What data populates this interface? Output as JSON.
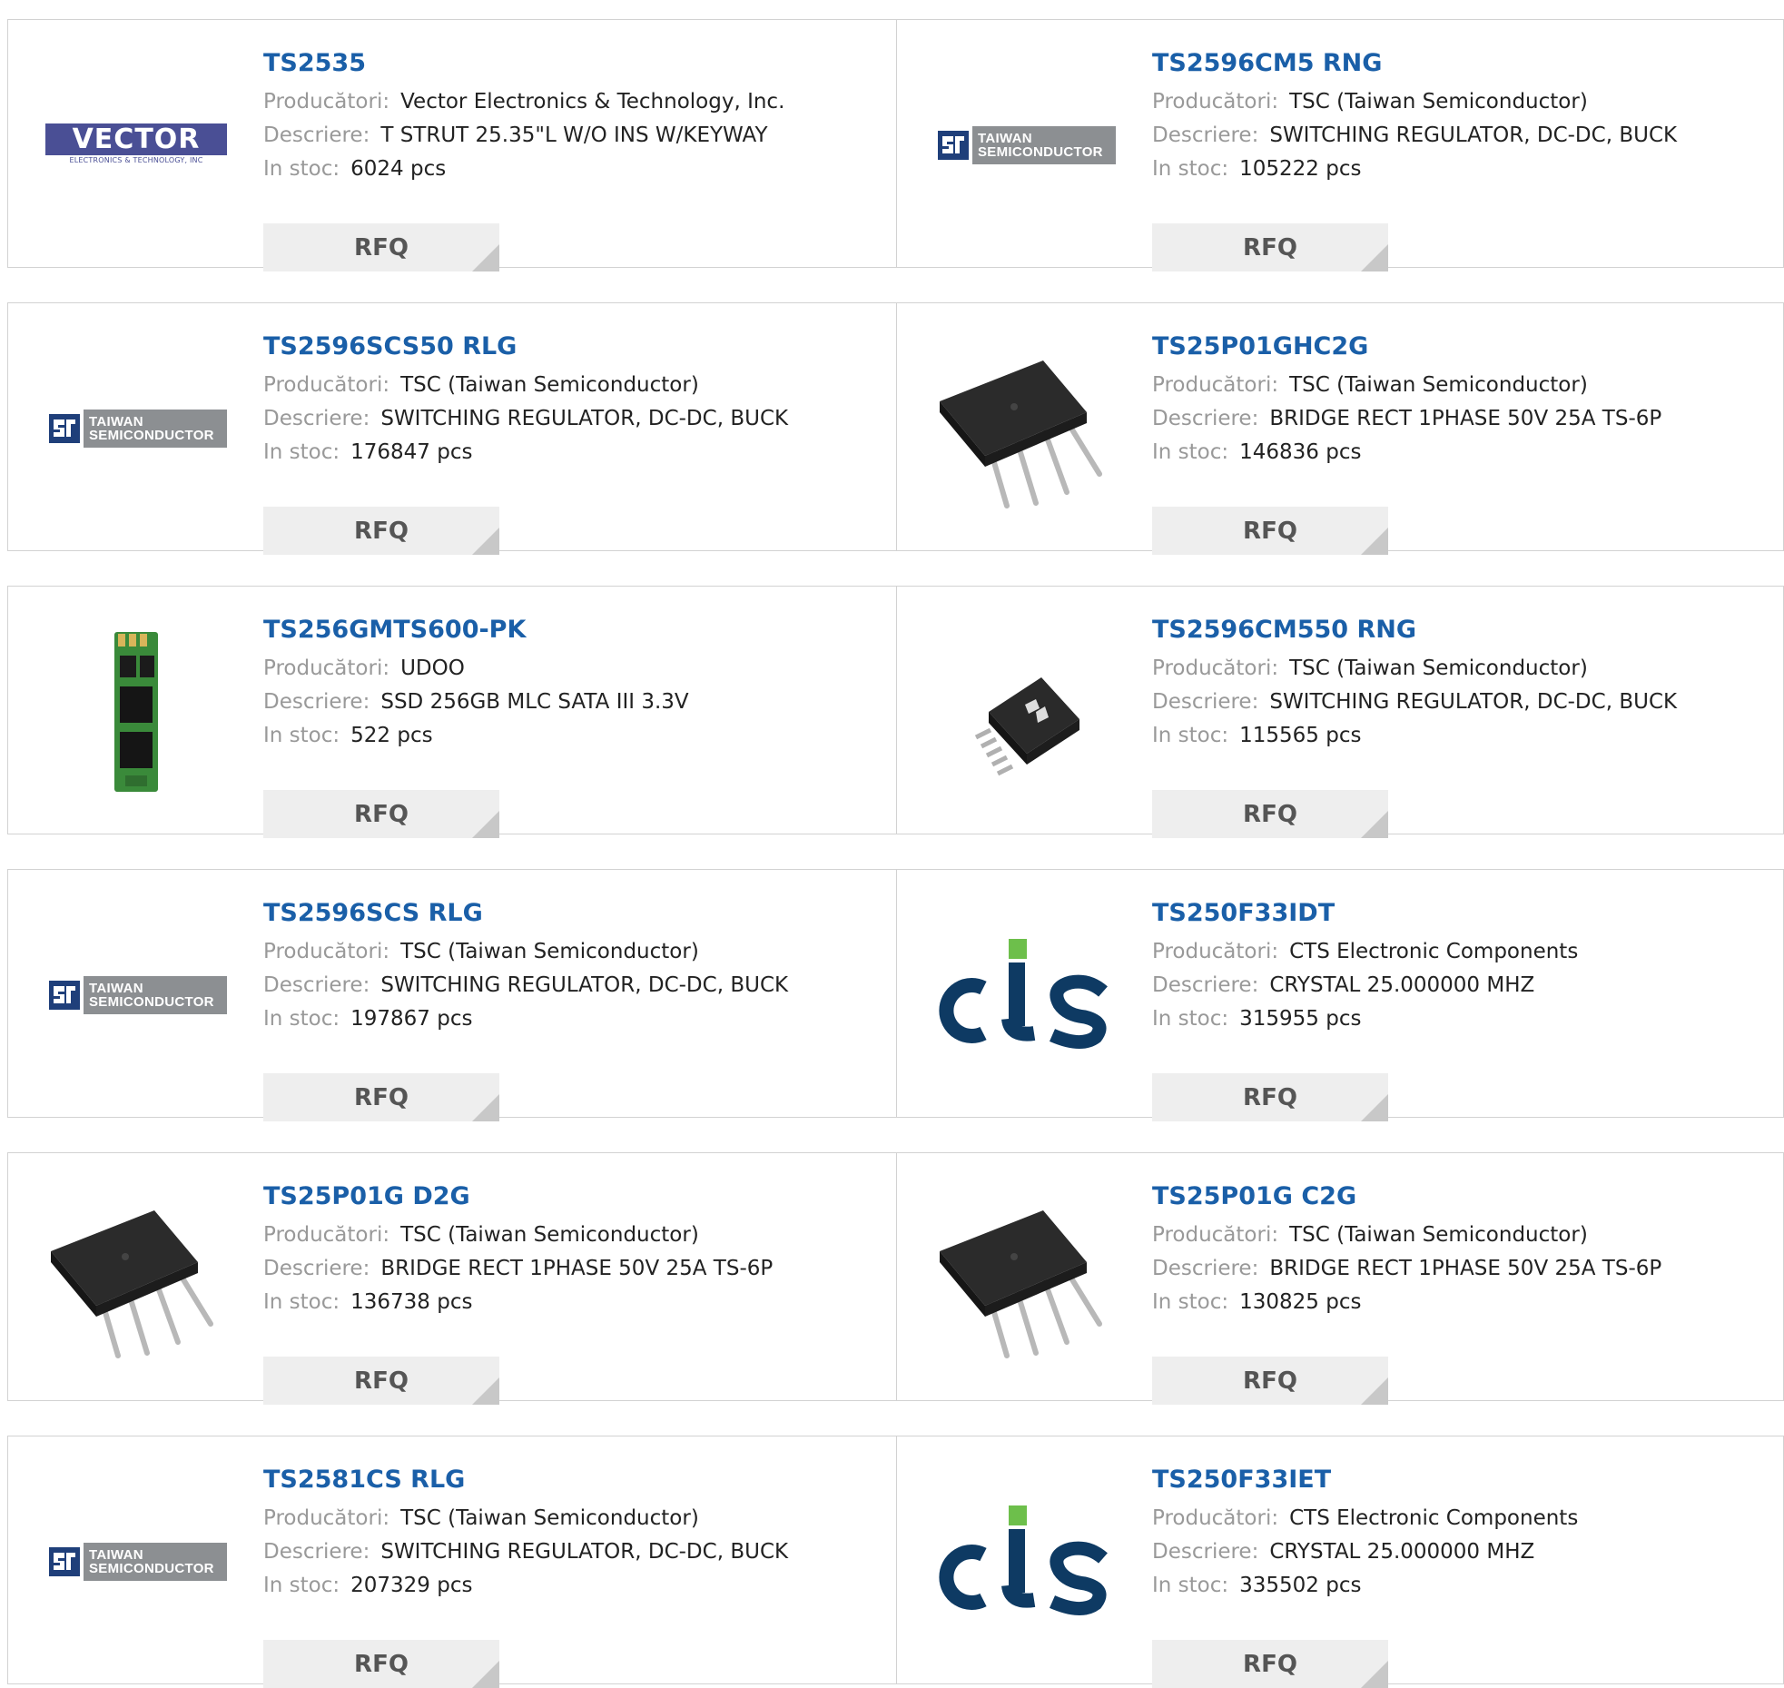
{
  "labels": {
    "manufacturer": "Producători:",
    "description": "Descriere:",
    "stock": "In stoc:",
    "rfq": "RFQ"
  },
  "logo_text": {
    "vector_title": "VECTOR",
    "vector_sub": "ELECTRONICS & TECHNOLOGY, INC",
    "tsc_line1": "TAIWAN",
    "tsc_line2": "SEMICONDUCTOR"
  },
  "colors": {
    "part_link": "#1a5fa8",
    "label_gray": "#999999",
    "rfq_bg": "#eeeeee",
    "cts_blue": "#0e3a63",
    "cts_green": "#6dbf4b",
    "tsc_gray": "#8c8f92",
    "vector_blue": "#4a4f95"
  },
  "products": [
    {
      "part": "TS2535",
      "manufacturer": "Vector Electronics & Technology, Inc.",
      "description": "T STRUT 25.35\"L W/O INS W/KEYWAY",
      "stock": "6024 pcs",
      "image": "vector-logo"
    },
    {
      "part": "TS2596CM5 RNG",
      "manufacturer": "TSC (Taiwan Semiconductor)",
      "description": "SWITCHING REGULATOR, DC-DC, BUCK",
      "stock": "105222 pcs",
      "image": "tsc-logo"
    },
    {
      "part": "TS2596SCS50 RLG",
      "manufacturer": "TSC (Taiwan Semiconductor)",
      "description": "SWITCHING REGULATOR, DC-DC, BUCK",
      "stock": "176847 pcs",
      "image": "tsc-logo"
    },
    {
      "part": "TS25P01GHC2G",
      "manufacturer": "TSC (Taiwan Semiconductor)",
      "description": "BRIDGE RECT 1PHASE 50V 25A TS-6P",
      "stock": "146836 pcs",
      "image": "bridge-rectifier-photo"
    },
    {
      "part": "TS256GMTS600-PK",
      "manufacturer": "UDOO",
      "description": "SSD 256GB MLC SATA III 3.3V",
      "stock": "522 pcs",
      "image": "m2-ssd-photo"
    },
    {
      "part": "TS2596CM550 RNG",
      "manufacturer": "TSC (Taiwan Semiconductor)",
      "description": "SWITCHING REGULATOR, DC-DC, BUCK",
      "stock": "115565 pcs",
      "image": "sop-chip-photo"
    },
    {
      "part": "TS2596SCS RLG",
      "manufacturer": "TSC (Taiwan Semiconductor)",
      "description": "SWITCHING REGULATOR, DC-DC, BUCK",
      "stock": "197867 pcs",
      "image": "tsc-logo"
    },
    {
      "part": "TS250F33IDT",
      "manufacturer": "CTS Electronic Components",
      "description": "CRYSTAL 25.000000 MHZ",
      "stock": "315955 pcs",
      "image": "cts-logo"
    },
    {
      "part": "TS25P01G D2G",
      "manufacturer": "TSC (Taiwan Semiconductor)",
      "description": "BRIDGE RECT 1PHASE 50V 25A TS-6P",
      "stock": "136738 pcs",
      "image": "bridge-rectifier-photo"
    },
    {
      "part": "TS25P01G C2G",
      "manufacturer": "TSC (Taiwan Semiconductor)",
      "description": "BRIDGE RECT 1PHASE 50V 25A TS-6P",
      "stock": "130825 pcs",
      "image": "bridge-rectifier-photo"
    },
    {
      "part": "TS2581CS RLG",
      "manufacturer": "TSC (Taiwan Semiconductor)",
      "description": "SWITCHING REGULATOR, DC-DC, BUCK",
      "stock": "207329 pcs",
      "image": "tsc-logo"
    },
    {
      "part": "TS250F33IET",
      "manufacturer": "CTS Electronic Components",
      "description": "CRYSTAL 25.000000 MHZ",
      "stock": "335502 pcs",
      "image": "cts-logo"
    }
  ]
}
